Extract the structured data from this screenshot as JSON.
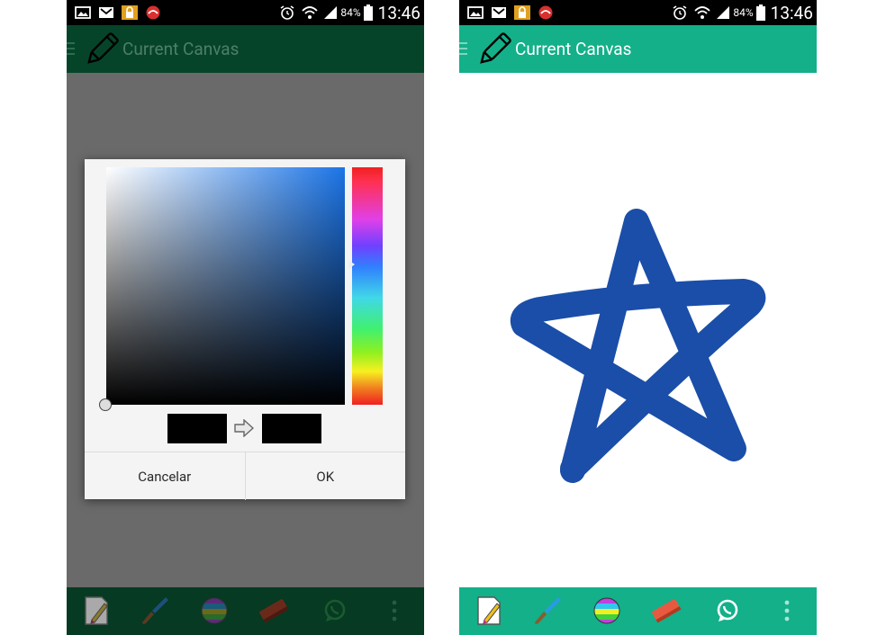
{
  "status_bar": {
    "battery_pct": "84%",
    "time": "13:46"
  },
  "app": {
    "title": "Current Canvas"
  },
  "dialog": {
    "cancel_label": "Cancelar",
    "ok_label": "OK",
    "selected_color": "#000000",
    "previous_color": "#000000",
    "hue_color": "#1b74e6"
  },
  "canvas": {
    "stroke_color": "#1a4ea8"
  },
  "toolbar": {
    "items": [
      "new-canvas-icon",
      "brush-icon",
      "color-palette-icon",
      "eraser-icon",
      "whatsapp-icon",
      "overflow-menu-icon"
    ]
  },
  "colors": {
    "primary": "#13b089",
    "primary_dimmed": "#06442a",
    "overlay": "#6a6a6a",
    "status_bar": "#000000"
  }
}
